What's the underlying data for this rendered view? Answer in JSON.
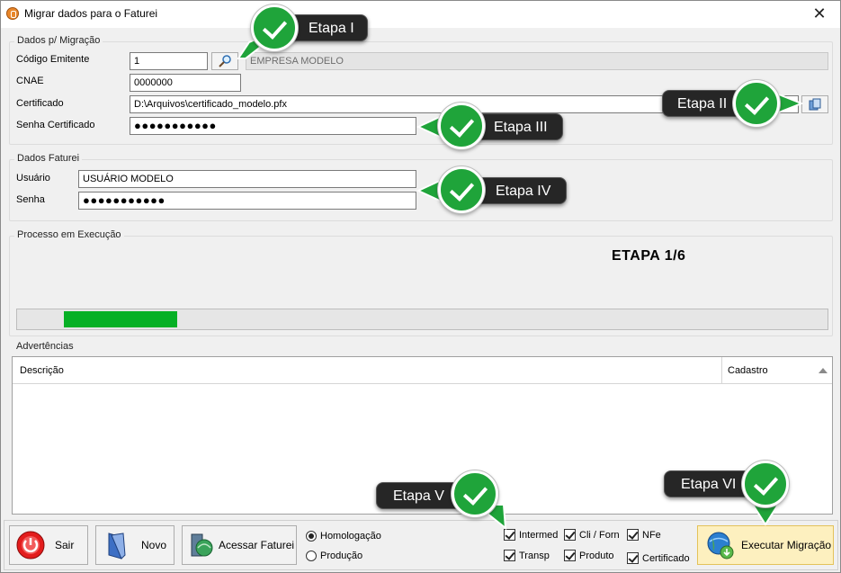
{
  "window": {
    "title": "Migrar dados para o Faturei",
    "close_glyph": "✕"
  },
  "dados_migracao": {
    "group_title": "Dados p/ Migração",
    "codigo_label": "Código Emitente",
    "codigo_value": "1",
    "empresa_value": "EMPRESA MODELO",
    "cnae_label": "CNAE",
    "cnae_value": "0000000",
    "certificado_label": "Certificado",
    "certificado_value": "D:\\Arquivos\\certificado_modelo.pfx",
    "senha_cert_label": "Senha Certificado",
    "senha_cert_value": "●●●●●●●●●●●"
  },
  "dados_faturei": {
    "group_title": "Dados Faturei",
    "usuario_label": "Usuário",
    "usuario_value": "USUÁRIO MODELO",
    "senha_label": "Senha",
    "senha_value": "●●●●●●●●●●●"
  },
  "processo": {
    "group_title": "Processo em Execução",
    "etapa_text": "ETAPA 1/6",
    "progress_fraction": 0.14
  },
  "advertencias": {
    "group_title": "Advertências",
    "columns": [
      "Descrição",
      "Cadastro"
    ]
  },
  "bottom": {
    "sair_label": "Sair",
    "novo_label": "Novo",
    "acessar_label": "Acessar Faturei",
    "executar_label": "Executar Migração",
    "radios": [
      {
        "label": "Homologação",
        "selected": true
      },
      {
        "label": "Produção",
        "selected": false
      }
    ],
    "checks": [
      "Intermed",
      "Cli / Forn",
      "NFe",
      "Transp",
      "Produto",
      "Certificado"
    ]
  },
  "callouts": [
    "Etapa I",
    "Etapa II",
    "Etapa III",
    "Etapa IV",
    "Etapa V",
    "Etapa VI"
  ],
  "colors": {
    "progress": "#06b025",
    "callout_bg": "#262626",
    "badge": "#1fa43a",
    "exec_button": "#fdf0bf"
  }
}
